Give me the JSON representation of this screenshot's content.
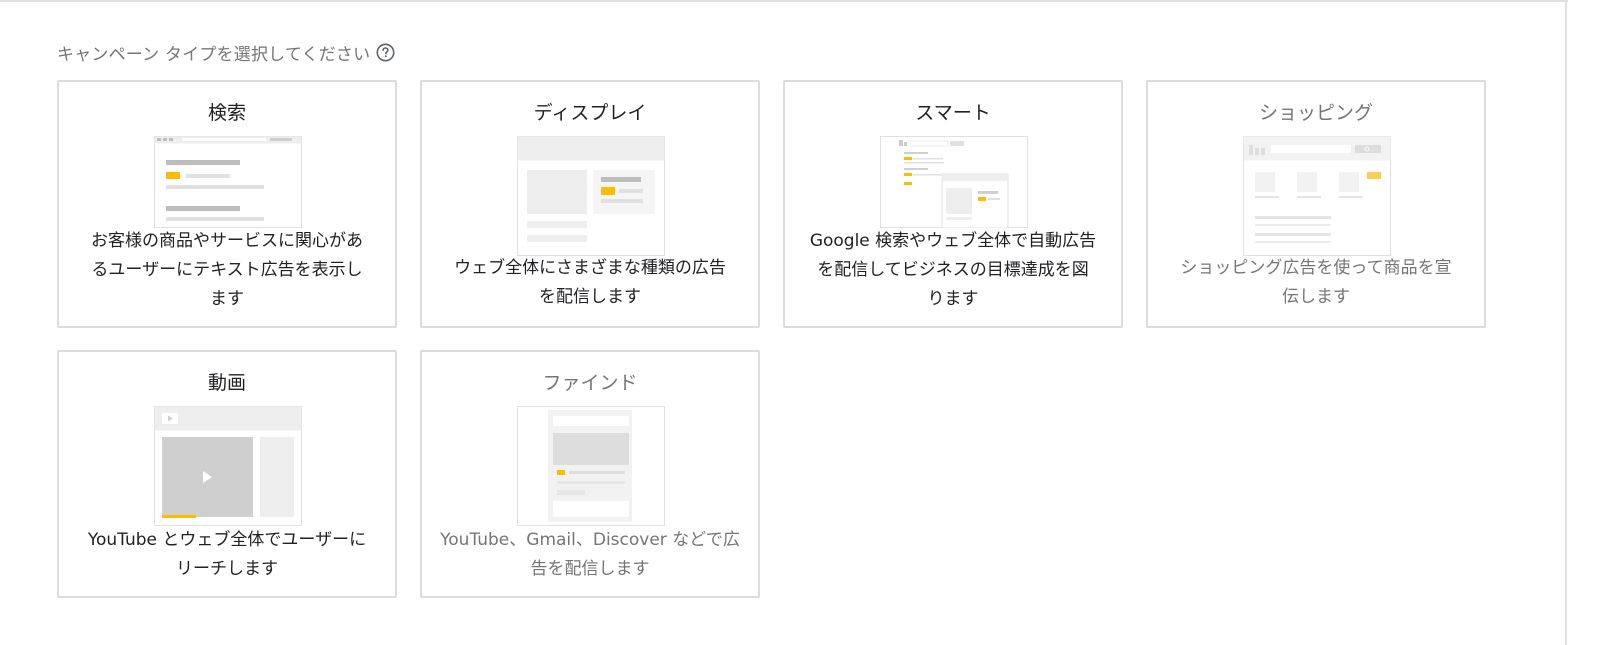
{
  "heading": "キャンペーン タイプを選択してください",
  "colors": {
    "accent": "#fbbc04",
    "border": "#dadce0",
    "mock_gray": "#e0e0e0"
  },
  "cards": [
    {
      "title": "検索",
      "desc": [
        "お客様の商品やサービスに関心があ",
        "るユーザーにテキスト広告を表示し",
        "ます"
      ]
    },
    {
      "title": "ディスプレイ",
      "desc": [
        "ウェブ全体にさまざまな種類の広告",
        "を配信します"
      ]
    },
    {
      "title": "スマート",
      "desc": [
        "Google 検索やウェブ全体で自動広告",
        "を配信してビジネスの目標達成を図",
        "ります"
      ]
    },
    {
      "title": "ショッピング",
      "desc": [
        "ショッピング広告を使って商品を宣",
        "伝します"
      ]
    },
    {
      "title": "動画",
      "desc": [
        "YouTube とウェブ全体でユーザーに",
        "リーチします"
      ]
    },
    {
      "title": "ファインド",
      "desc": [
        "YouTube、Gmail、Discover などで広",
        "告を配信します"
      ]
    }
  ]
}
